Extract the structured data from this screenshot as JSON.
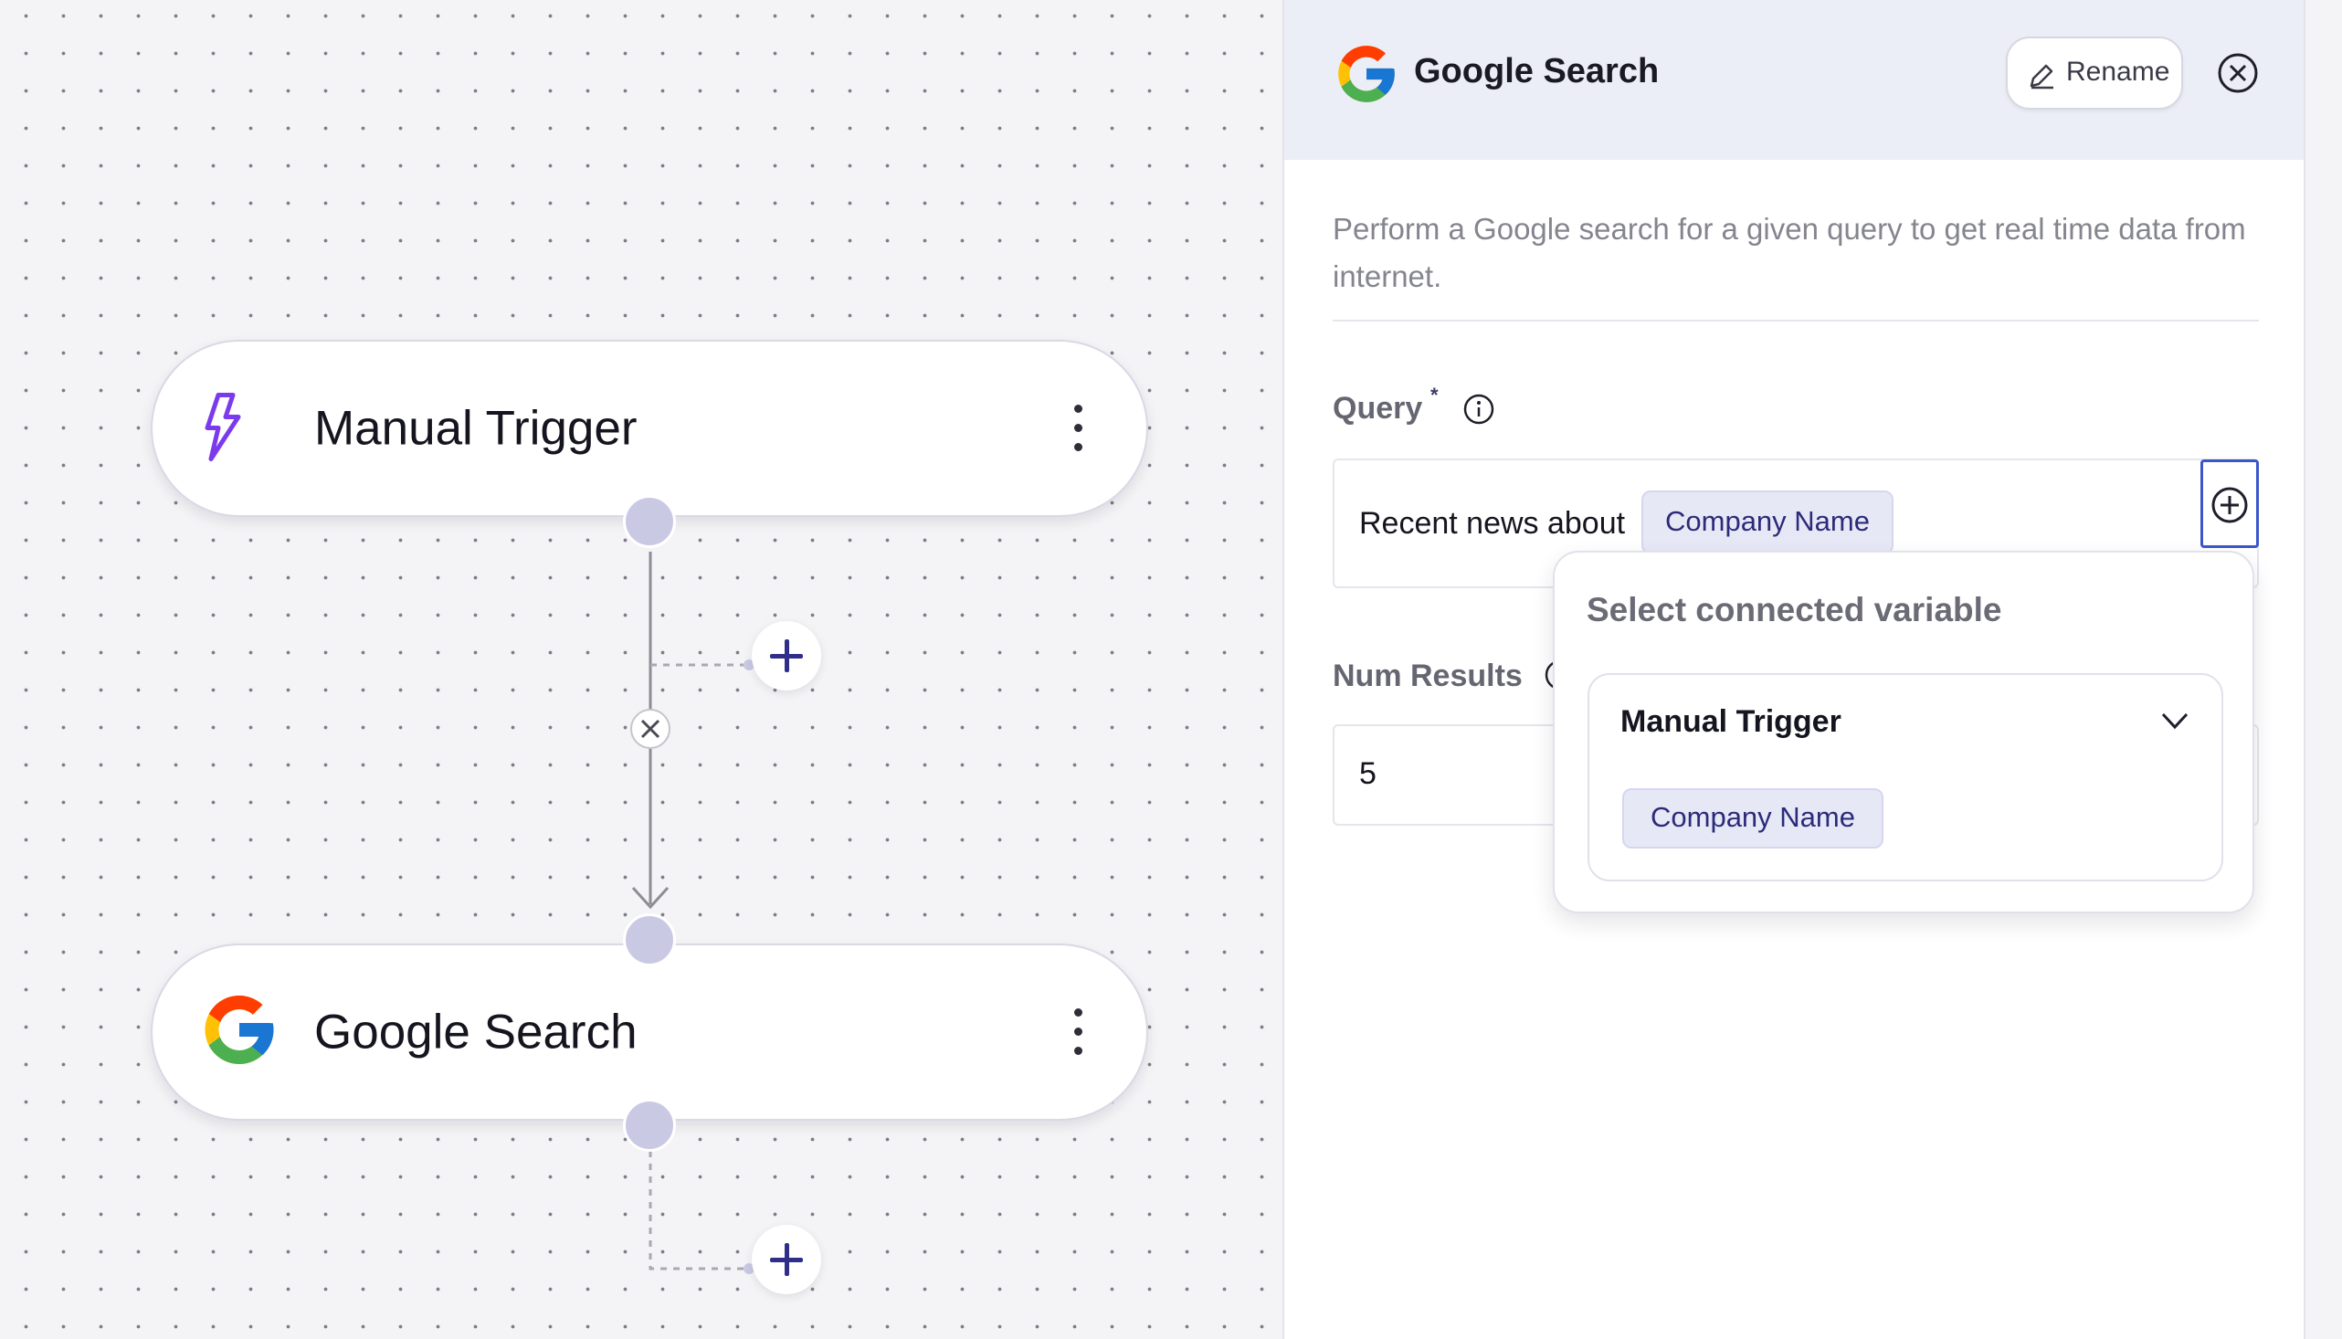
{
  "canvas": {
    "nodes": [
      {
        "title": "Manual Trigger",
        "icon": "lightning-icon"
      },
      {
        "title": "Google Search",
        "icon": "google-icon"
      }
    ]
  },
  "panel": {
    "title": "Google Search",
    "rename_label": "Rename",
    "description": "Perform a Google search for a given query to get real time data from internet.",
    "query": {
      "label": "Query",
      "required_mark": "*",
      "text": "Recent news about",
      "variable_chip": "Company Name"
    },
    "num_results": {
      "label": "Num Results",
      "value": "5"
    }
  },
  "popover": {
    "title": "Select connected variable",
    "group_title": "Manual Trigger",
    "variables": [
      "Company Name"
    ]
  },
  "colors": {
    "accent": "#2f2f8a",
    "handle": "#c9c9e4",
    "trigger_icon": "#7c3aed",
    "insert_button_border": "#3a57c9"
  }
}
